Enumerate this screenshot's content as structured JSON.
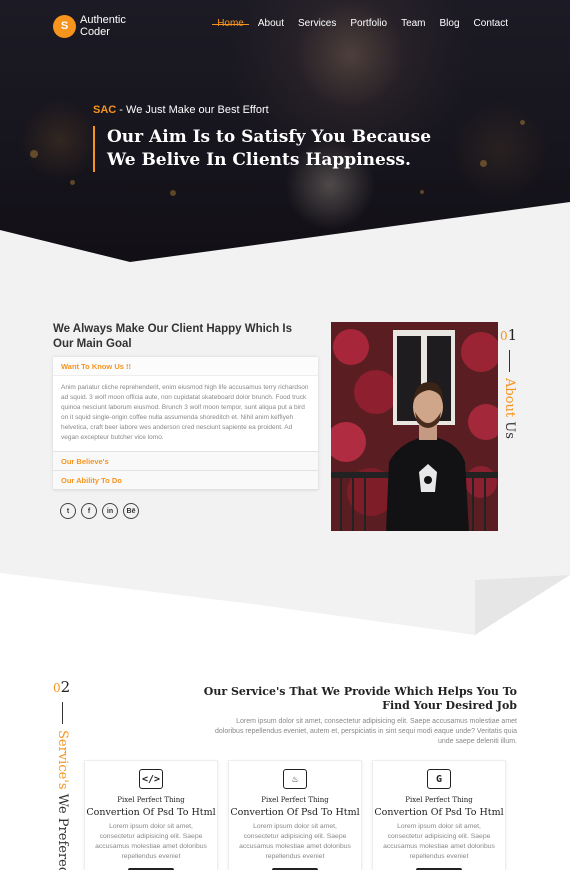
{
  "brand": {
    "badge": "S",
    "name": "Authentic Coder"
  },
  "nav": [
    "Home",
    "About",
    "Services",
    "Portfolio",
    "Team",
    "Blog",
    "Contact"
  ],
  "hero": {
    "tag_strong": "SAC",
    "tag_rest": " - We Just Make our Best Effort",
    "heading": "Our Aim Is to Satisfy You Because We Belive In Clients Happiness."
  },
  "about": {
    "title": "We Always Make Our Client Happy Which Is Our Main Goal",
    "accordion": [
      {
        "title": "Want To Know Us !!",
        "body": "Anim pariatur cliche reprehenderit, enim eiusmod high life accusamus terry richardson ad squid. 3 wolf moon officia aute, non cupidatat skateboard dolor brunch. Food truck quinoa nesciunt laborum eiusmod. Brunch 3 wolf moon tempor, sunt aliqua put a bird on it squid single-origin coffee nulla assumenda shoreditch et. Nihil anim keffiyeh helvetica, craft beer labore wes anderson cred nesciunt sapiente ea proident. Ad vegan excepteur butcher vice lomo."
      },
      {
        "title": "Our Believe's"
      },
      {
        "title": "Our Ability To Do"
      }
    ],
    "socials": [
      "twitter-icon",
      "facebook-icon",
      "linkedin-icon",
      "behance-icon"
    ],
    "social_glyphs": [
      "t",
      "f",
      "in",
      "Bē"
    ],
    "section_num_accent": "0",
    "section_num": "1",
    "side_accent": "About",
    "side_rest": " Us"
  },
  "services": {
    "section_num_accent": "0",
    "section_num": "2",
    "side_accent": "Service's",
    "side_rest": " We Prefered",
    "heading": "Our Service's That We Provide Which Helps You To Find Your Desired Job",
    "description": "Lorem ipsum dolor sit amet, consectetur adipisicing elit. Saepe accusamus molestiae amet doloribus repellendus eveniet, autem et, perspiciatis in sint sequi modi eaque unde? Veritatis quia unde saepe deleniti illum.",
    "cards": [
      {
        "icon": "code-icon",
        "glyph": "</>",
        "kicker": "Pixel Perfect Thing",
        "title": "Convertion Of Psd To Html",
        "text": "Lorem ipsum dolor sit amet, consectetur adipisicing elit. Saepe accusamus molestiae amet doloribus repellendus eveniet"
      },
      {
        "icon": "flame-icon",
        "glyph": "♨",
        "kicker": "Pixel Perfect Thing",
        "title": "Convertion Of Psd To Html",
        "text": "Lorem ipsum dolor sit amet, consectetur adipisicing elit. Saepe accusamus molestiae amet doloribus repellendus eveniet"
      },
      {
        "icon": "google-icon",
        "glyph": "G",
        "kicker": "Pixel Perfect Thing",
        "title": "Convertion Of Psd To Html",
        "text": "Lorem ipsum dolor sit amet, consectetur adipisicing elit. Saepe accusamus molestiae amet doloribus repellendus eveniet"
      }
    ]
  },
  "colors": {
    "accent": "#f7941d",
    "dark": "#16141c",
    "gray_band": "#f2f2f2"
  }
}
